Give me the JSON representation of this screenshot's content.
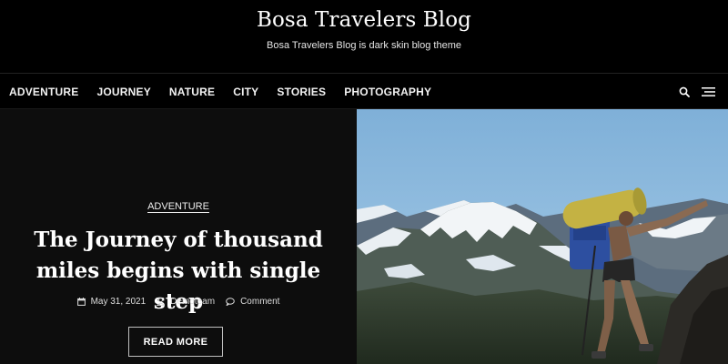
{
  "site": {
    "title": "Bosa Travelers Blog",
    "description": "Bosa Travelers Blog is dark skin blog theme"
  },
  "nav": {
    "items": [
      {
        "label": "ADVENTURE"
      },
      {
        "label": "JOURNEY"
      },
      {
        "label": "NATURE"
      },
      {
        "label": "CITY"
      },
      {
        "label": "STORIES"
      },
      {
        "label": "PHOTOGRAPHY"
      }
    ],
    "icons": [
      "search-icon",
      "menu-icon"
    ]
  },
  "featured": {
    "category": "ADVENTURE",
    "title": "The Journey of thousand miles begins with single step",
    "date": "May 31, 2021",
    "author": "Demoteam",
    "comment_label": "Comment",
    "button_label": "READ MORE",
    "icons": [
      "calendar-icon",
      "user-icon",
      "comment-icon"
    ]
  },
  "colors": {
    "background": "#000000",
    "panel": "#0d0d0d",
    "text": "#ffffff",
    "button_border": "#bfbfbf"
  }
}
